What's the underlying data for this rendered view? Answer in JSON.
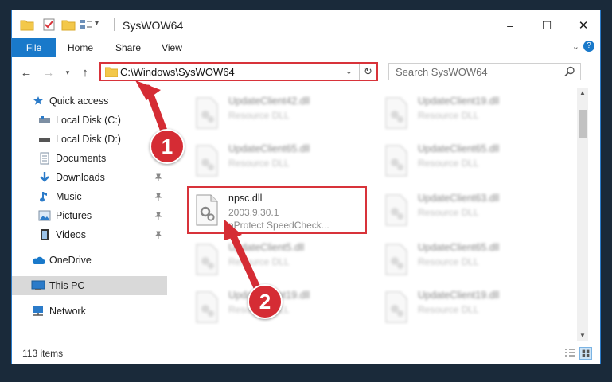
{
  "window": {
    "title": "SysWOW64",
    "controls": {
      "minimize": "–",
      "maximize": "☐",
      "close": "✕"
    }
  },
  "ribbon": {
    "tabs": [
      {
        "label": "File",
        "active": true
      },
      {
        "label": "Home"
      },
      {
        "label": "Share"
      },
      {
        "label": "View"
      }
    ]
  },
  "address": {
    "path": "C:\\Windows\\SysWOW64",
    "search_placeholder": "Search SysWOW64"
  },
  "nav_pane": {
    "items": [
      {
        "label": "Quick access",
        "icon": "star-icon"
      },
      {
        "label": "Local Disk (C:)",
        "icon": "drive-icon"
      },
      {
        "label": "Local Disk (D:)",
        "icon": "drive-icon"
      },
      {
        "label": "Documents",
        "icon": "documents-icon",
        "pinned": true
      },
      {
        "label": "Downloads",
        "icon": "download-icon",
        "pinned": true
      },
      {
        "label": "Music",
        "icon": "music-icon",
        "pinned": true
      },
      {
        "label": "Pictures",
        "icon": "pictures-icon",
        "pinned": true
      },
      {
        "label": "Videos",
        "icon": "videos-icon",
        "pinned": true
      },
      {
        "label": "OneDrive",
        "icon": "cloud-icon"
      },
      {
        "label": "This PC",
        "icon": "computer-icon",
        "selected": true
      },
      {
        "label": "Network",
        "icon": "network-icon"
      }
    ]
  },
  "files": {
    "left": [
      {
        "name": "UpdateClient42.dll",
        "type": "Resource DLL"
      },
      {
        "name": "UpdateClient65.dll",
        "type": "Resource DLL"
      },
      {
        "name": "npsc.dll",
        "version": "2003.9.30.1",
        "description": "nProtect SpeedCheck..."
      },
      {
        "name": "UpdateClient5.dll",
        "type": "Resource DLL"
      },
      {
        "name": "UpdateClient19.dll",
        "type": "Resource DLL"
      }
    ],
    "right": [
      {
        "name": "UpdateClient19.dll",
        "type": "Resource DLL"
      },
      {
        "name": "UpdateClient65.dll",
        "type": "Resource DLL"
      },
      {
        "name": "UpdateClient63.dll",
        "type": "Resource DLL"
      },
      {
        "name": "UpdateClient65.dll",
        "type": "Resource DLL"
      },
      {
        "name": "UpdateClient19.dll",
        "type": "Resource DLL"
      }
    ]
  },
  "status": {
    "item_count": "113 items"
  },
  "annotations": {
    "step1": "1",
    "step2": "2",
    "color": "#d52c34"
  }
}
